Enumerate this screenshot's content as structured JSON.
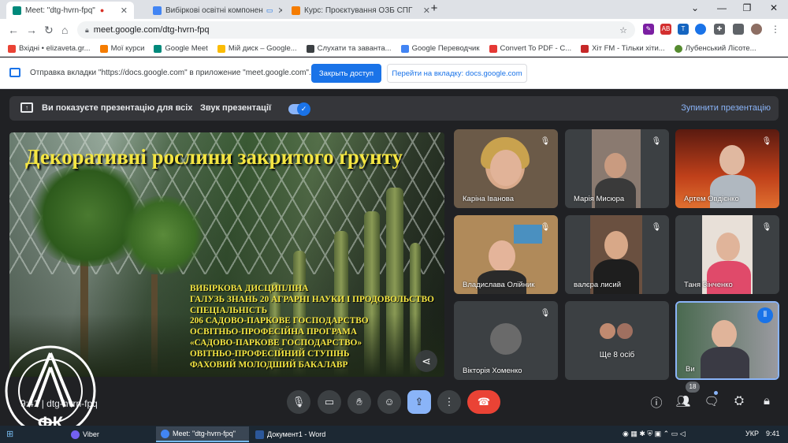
{
  "browser": {
    "tabs": [
      {
        "label": "Meet: \"dtg-hvrn-fpq\"",
        "icon": "meet-icon",
        "active": true
      },
      {
        "label": "Вибіркові освітні компонен",
        "icon": "docs-icon",
        "active": false
      },
      {
        "label": "Курс: Проєктування ОЗБ СПГ",
        "icon": "moodle-icon",
        "active": false
      }
    ],
    "new_tab": "+",
    "window_controls": [
      "⌄",
      "—",
      "❐",
      "✕"
    ],
    "url": "meet.google.com/dtg-hvrn-fpq",
    "bookmarks": [
      {
        "label": "Вхідні • elizaveta.gr...",
        "icon": "gmail-icon"
      },
      {
        "label": "Мої курси",
        "icon": "moodle-icon"
      },
      {
        "label": "Google Meet",
        "icon": "meet-icon"
      },
      {
        "label": "Мій диск – Google...",
        "icon": "drive-icon"
      },
      {
        "label": "Слухати та заванта...",
        "icon": "music-icon"
      },
      {
        "label": "Google Переводчик",
        "icon": "translate-icon"
      },
      {
        "label": "Convert To PDF - C...",
        "icon": "pdf-icon"
      },
      {
        "label": "Хіт FM - Тільки хіти...",
        "icon": "radio-icon"
      },
      {
        "label": "Лубенський Лісоте...",
        "icon": "college-icon"
      }
    ]
  },
  "infobar": {
    "text": "Отправка вкладки \"https://docs.google.com\" в приложение \"meet.google.com\"...",
    "grant_button": "Закрыть доступ",
    "switch_button": "Перейти на вкладку: docs.google.com"
  },
  "meet": {
    "present_bar": {
      "showing_text": "Ви показуєте презентацію для всіх",
      "sound_label": "Звук презентації",
      "sound_on": true,
      "stop_label": "Зупинити презентацію"
    },
    "slide": {
      "title": "Декоративні рослини закритого ґрунту",
      "lines": [
        "ВИБІРКОВА ДИСЦИПЛІНА",
        "ГАЛУЗЬ ЗНАНЬ 20 АГРАРНІ НАУКИ І ПРОДОВОЛЬСТВО",
        "СПЕЦІАЛЬНІСТЬ",
        "206 САДОВО-ПАРКОВЕ ГОСПОДАРСТВО",
        "ОСВІТНЬО-ПРОФЕСІЙНА ПРОГРАМА",
        "«САДОВО-ПАРКОВЕ ГОСПОДАРСТВО»",
        "ОВІТНЬО-ПРОФЕСІЙНИЙ СТУПІНЬ",
        "ФАХОВИЙ МОЛОДШИЙ БАКАЛАВР"
      ]
    },
    "participants": [
      {
        "name": "Каріна Іванова",
        "muted": true
      },
      {
        "name": "Марія Мисюра",
        "muted": true
      },
      {
        "name": "Артем Овдієнко",
        "muted": true
      },
      {
        "name": "Владислава Олійник",
        "muted": true
      },
      {
        "name": "валєра лисий",
        "muted": true
      },
      {
        "name": "Таня Зінченко",
        "muted": true
      },
      {
        "name": "Вікторія Хоменко",
        "muted": true
      },
      {
        "name": "Ще 8 осіб",
        "muted": false
      },
      {
        "name": "Ви",
        "muted": false
      }
    ],
    "controls": {
      "time": "9:41",
      "meeting_code": "dtg-hvrn-fpq",
      "people_count": "18"
    }
  },
  "logo": {
    "text_arc": "ЛУБЕНСЬКИЙ ЛІСОТЕХНІЧНИЙ ФАХОВИЙ КОЛЕДЖ",
    "letters": "ФК"
  },
  "taskbar": {
    "items": [
      {
        "label": "Viber",
        "icon": "viber-icon"
      },
      {
        "label": "Meet: \"dtg-hvrn-fpq\"",
        "icon": "chrome-icon"
      },
      {
        "label": "Документ1 - Word",
        "icon": "word-icon"
      }
    ],
    "language": "УКР",
    "clock": "9:41"
  },
  "colors": {
    "meet_bg": "#202124",
    "accent_blue": "#1a73e8",
    "end_call_red": "#ea4335",
    "slide_text_yellow": "#f5e642"
  }
}
